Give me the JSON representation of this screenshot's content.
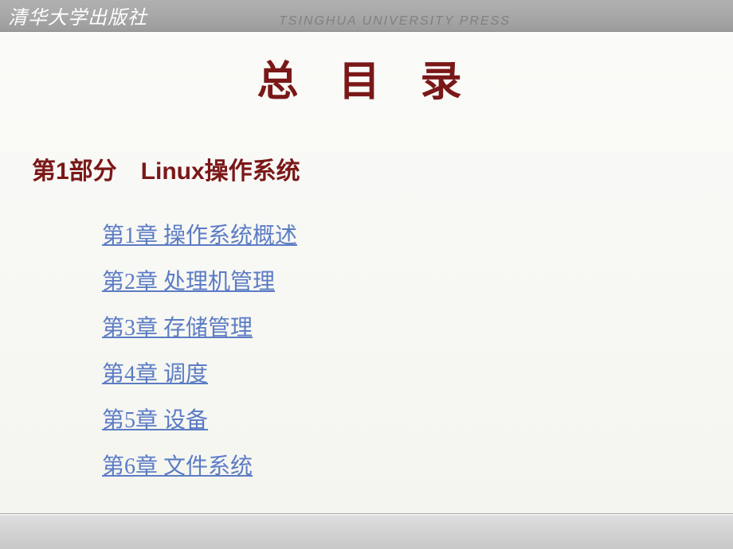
{
  "header": {
    "publisher_cn": "清华大学出版社",
    "publisher_en": "TSINGHUA UNIVERSITY PRESS"
  },
  "title": "总 目 录",
  "section": {
    "label": "第1部分　Linux操作系统"
  },
  "chapters": [
    {
      "label": "第1章  操作系统概述"
    },
    {
      "label": "第2章  处理机管理"
    },
    {
      "label": "第3章  存储管理"
    },
    {
      "label": "第4章  调度"
    },
    {
      "label": "第5章  设备"
    },
    {
      "label": "第6章  文件系统"
    }
  ]
}
